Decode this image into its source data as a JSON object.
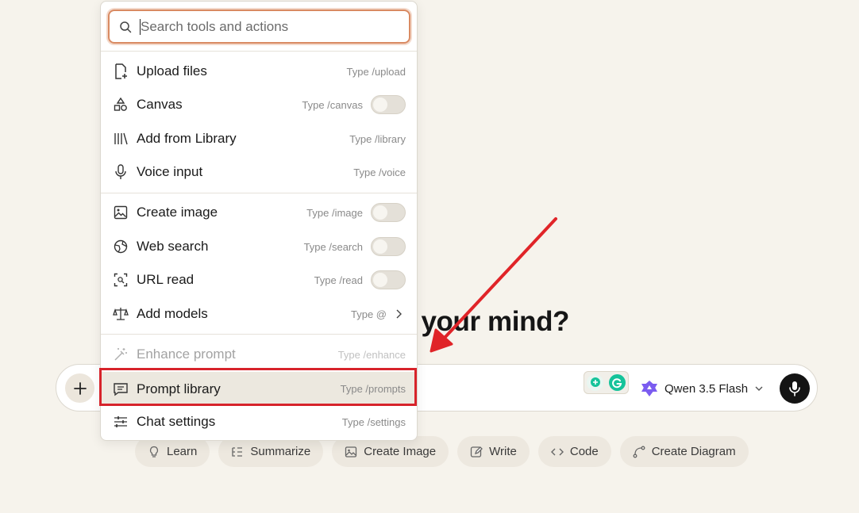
{
  "headline": "What's on your mind?",
  "menu": {
    "search_placeholder": "Search tools and actions",
    "groups": [
      [
        {
          "label": "Upload files",
          "hint": "Type /upload",
          "icon": "file-upload-icon"
        },
        {
          "label": "Canvas",
          "hint": "Type /canvas",
          "icon": "shapes-icon",
          "toggle": false
        },
        {
          "label": "Add from Library",
          "hint": "Type /library",
          "icon": "library-icon"
        },
        {
          "label": "Voice input",
          "hint": "Type /voice",
          "icon": "microphone-icon"
        }
      ],
      [
        {
          "label": "Create image",
          "hint": "Type /image",
          "icon": "image-icon",
          "toggle": false
        },
        {
          "label": "Web search",
          "hint": "Type /search",
          "icon": "globe-icon",
          "toggle": false
        },
        {
          "label": "URL read",
          "hint": "Type /read",
          "icon": "url-scan-icon",
          "toggle": false
        },
        {
          "label": "Add models",
          "hint": "Type @",
          "icon": "scale-icon",
          "chevron": true
        }
      ],
      [
        {
          "label": "Enhance prompt",
          "hint": "Type /enhance",
          "icon": "magic-wand-icon",
          "disabled": true
        },
        {
          "label": "Prompt library",
          "hint": "Type /prompts",
          "icon": "message-lines-icon",
          "highlighted": true
        },
        {
          "label": "Chat settings",
          "hint": "Type /settings",
          "icon": "sliders-icon"
        }
      ]
    ]
  },
  "chatbar": {
    "model_name": "Qwen 3.5 Flash"
  },
  "chips": [
    {
      "label": "Learn",
      "icon": "lightbulb-icon"
    },
    {
      "label": "Summarize",
      "icon": "list-icon"
    },
    {
      "label": "Create Image",
      "icon": "image-icon"
    },
    {
      "label": "Write",
      "icon": "pencil-icon"
    },
    {
      "label": "Code",
      "icon": "code-icon"
    },
    {
      "label": "Create Diagram",
      "icon": "diagram-icon"
    }
  ],
  "colors": {
    "background": "#f6f3ec",
    "highlight_border": "#d7232b",
    "arrow": "#e02428",
    "search_focus": "#d98a62",
    "model_logo": "#7b5cf0",
    "grammarly_green": "#15c39a"
  }
}
